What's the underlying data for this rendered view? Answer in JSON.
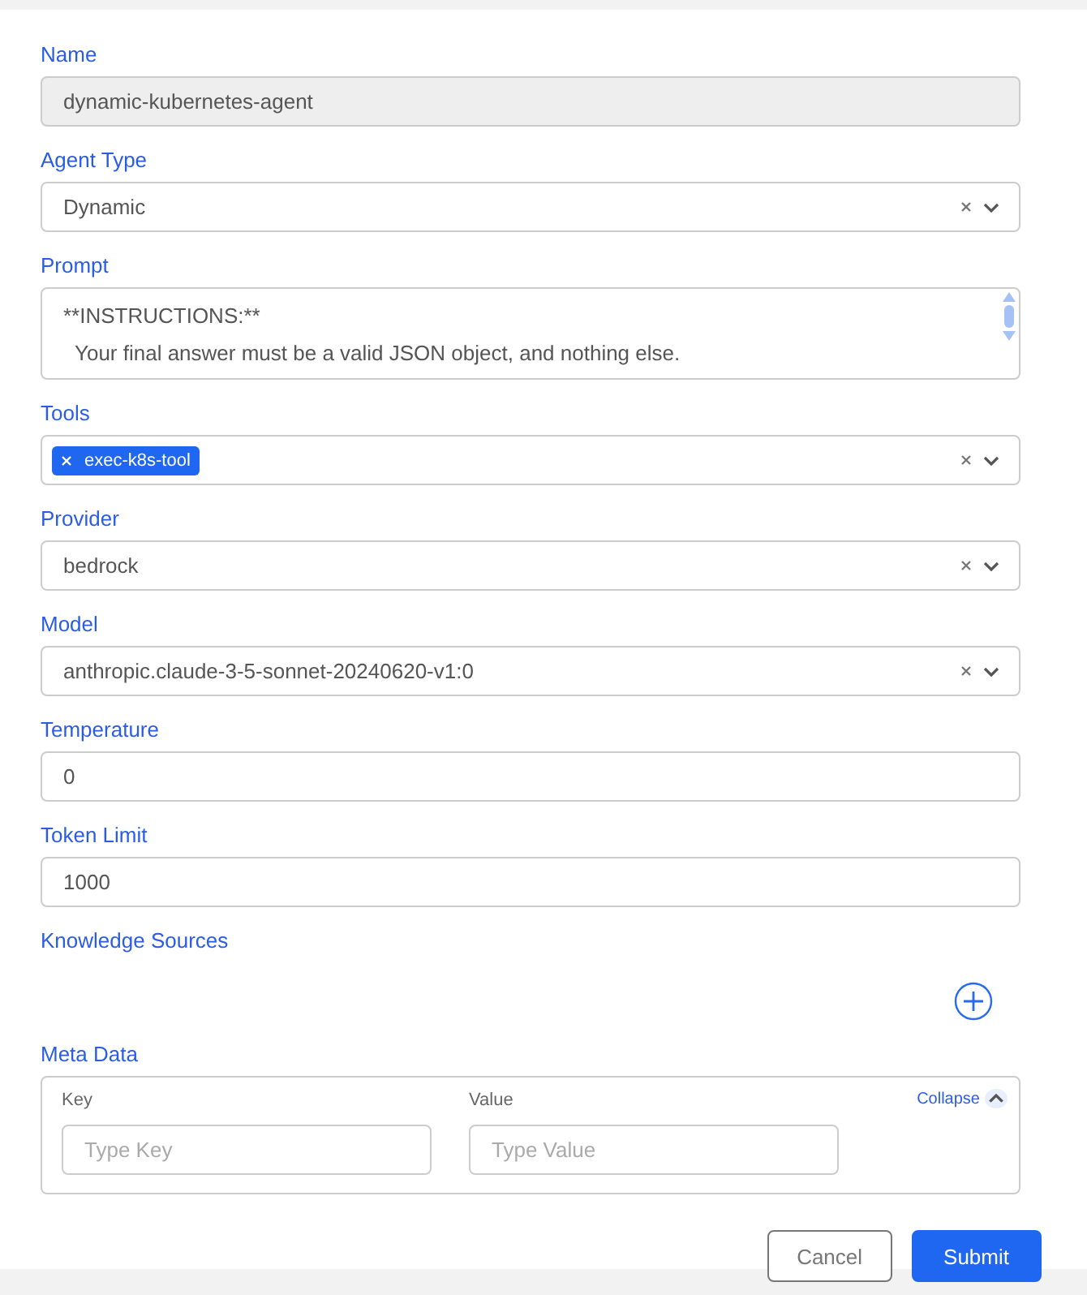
{
  "fields": [
    {
      "kind": "text",
      "label": "Name",
      "value": "dynamic-kubernetes-agent",
      "disabled": true
    },
    {
      "kind": "select",
      "label": "Agent Type",
      "value": "Dynamic",
      "disabled": false
    },
    {
      "kind": "textarea",
      "label": "Prompt",
      "lines": [
        "**INSTRUCTIONS:**",
        "  Your final answer must be a valid JSON object, and nothing else."
      ],
      "disabled": false
    },
    {
      "kind": "tags",
      "label": "Tools",
      "tags": [
        "exec-k8s-tool"
      ],
      "disabled": false
    },
    {
      "kind": "select",
      "label": "Provider",
      "value": "bedrock",
      "disabled": false
    },
    {
      "kind": "select",
      "label": "Model",
      "value": "anthropic.claude-3-5-sonnet-20240620-v1:0",
      "disabled": false
    },
    {
      "kind": "text",
      "label": "Temperature",
      "value": "0",
      "disabled": false
    },
    {
      "kind": "text",
      "label": "Token Limit",
      "value": "1000",
      "disabled": false
    },
    {
      "kind": "adder",
      "label": "Knowledge Sources"
    },
    {
      "kind": "keyvalue",
      "label": "Meta Data",
      "key_label": "Key",
      "value_label": "Value",
      "key_placeholder": "Type Key",
      "value_placeholder": "Type Value",
      "toggle": "Collapse",
      "expanded": true
    }
  ],
  "buttons": [
    {
      "label": "Cancel",
      "kind": "secondary"
    },
    {
      "label": "Submit",
      "kind": "primary"
    }
  ]
}
